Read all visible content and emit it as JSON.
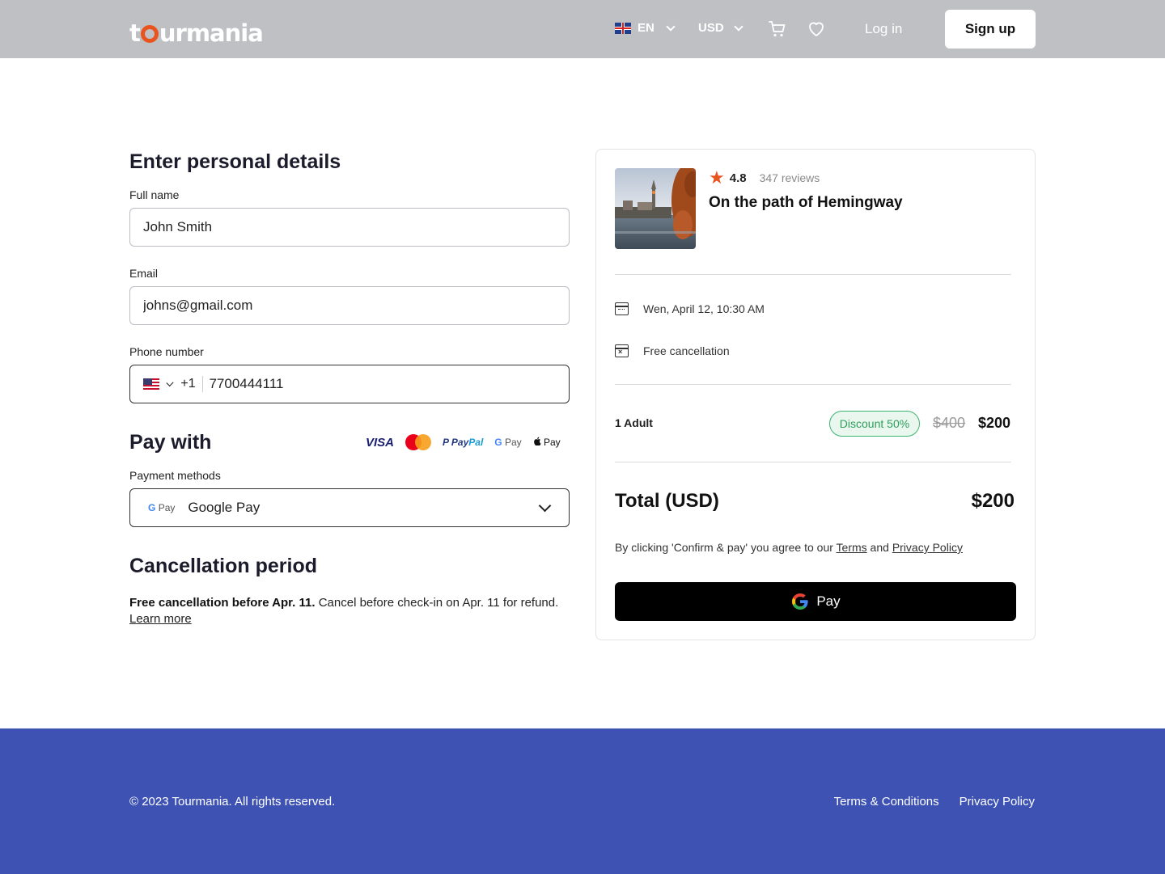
{
  "header": {
    "logo": "tourmania",
    "language": "EN",
    "currency": "USD",
    "login_label": "Log in",
    "signup_label": "Sign up"
  },
  "personal": {
    "title": "Enter personal details",
    "full_name_label": "Full name",
    "full_name_value": "John Smith",
    "email_label": "Email",
    "email_value": "johns@gmail.com",
    "phone_label": "Phone number",
    "phone_country_code": "+1",
    "phone_value": "7700444111"
  },
  "payment": {
    "title": "Pay with",
    "logos": {
      "visa": "VISA",
      "paypal_a": "Pay",
      "paypal_b": "Pal",
      "gpay_g": "G",
      "gpay_text": "Pay",
      "apple_pay": " Pay"
    },
    "methods_label": "Payment methods",
    "selected_method": "Google Pay"
  },
  "cancellation": {
    "title": "Cancellation period",
    "bold_text": "Free cancellation before Apr. 11.",
    "text": " Cancel before check-in on Apr. 11 for refund.",
    "learn_more": "Learn more"
  },
  "summary": {
    "rating": "4.8",
    "reviews": "347 reviews",
    "tour_title": "On the path of Hemingway",
    "date": "Wen, April 12, 10:30 AM",
    "cancellation": "Free cancellation",
    "adult_label": "1 Adult",
    "discount": "Discount 50%",
    "old_price": "$400",
    "new_price": "$200",
    "total_label": "Total (USD)",
    "total_value": "$200",
    "agree_text": "By clicking 'Confirm & pay' you agree to our ",
    "terms_link": "Terms",
    "and_text": " and ",
    "privacy_link": "Privacy Policy",
    "pay_button_label": "Pay"
  },
  "footer": {
    "copyright": "© 2023 Tourmania. All rights reserved.",
    "terms_link": "Terms & Conditions",
    "privacy_link": "Privacy Policy"
  },
  "colors": {
    "header_bg": "#bfc0c4",
    "brand_orange": "#e9541e",
    "footer_bg": "#3d52b3",
    "discount_green": "#2e9e5b"
  }
}
